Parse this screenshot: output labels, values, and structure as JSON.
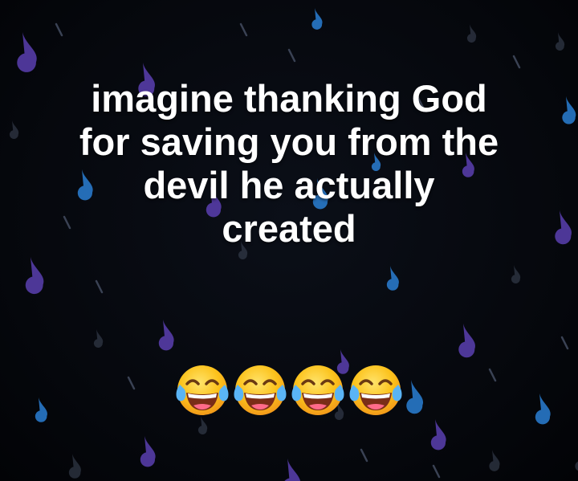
{
  "post": {
    "background_color": "#05070c",
    "text_color": "#ffffff",
    "drop_colors": [
      "#5a3fb0",
      "#2a7fd4",
      "#3a4254"
    ],
    "caption_lines": [
      "imagine thanking God",
      "for saving you from the",
      "devil he actually",
      "created"
    ],
    "emoji": {
      "name": "face-with-tears-of-joy-icon",
      "count": 4
    }
  }
}
